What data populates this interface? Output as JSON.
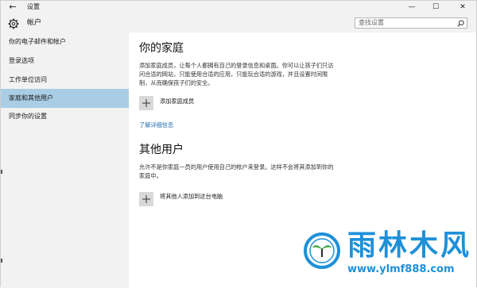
{
  "window": {
    "title": "设置",
    "back_glyph": "←",
    "controls": {
      "minimize": "—",
      "maximize": "☐",
      "close": "✕"
    }
  },
  "header": {
    "icon": "gear-icon",
    "title": "帐户",
    "search_placeholder": "查找设置"
  },
  "sidebar": {
    "items": [
      {
        "label": "你的电子邮件和帐户",
        "selected": false
      },
      {
        "label": "登录选项",
        "selected": false
      },
      {
        "label": "工作单位访问",
        "selected": false
      },
      {
        "label": "家庭和其他用户",
        "selected": true
      },
      {
        "label": "同步你的设置",
        "selected": false
      }
    ],
    "selected_color": "#a9cde5"
  },
  "main": {
    "family": {
      "title": "你的家庭",
      "description": "添加家庭成员，让每个人都拥有自己的登录信息和桌面。你可以让孩子们只访问合适的网站，只能使用合适的应用，只能玩合适的游戏，并且设置时间限制，从而确保孩子们的安全。",
      "add_label": "添加家庭成员",
      "learn_more": "了解详细信息"
    },
    "others": {
      "title": "其他用户",
      "description": "允许不是你家庭一员的用户使用自己的帐户来登录。这样不会将其添加到你的家庭中。",
      "add_label": "将其他人添加到这台电脑"
    }
  },
  "watermark": {
    "title": "雨林木风",
    "url": "www.ylmf888.com",
    "color": "#1e90d8"
  },
  "colors": {
    "chrome_bg": "#f2f2f2",
    "link": "#2a6fb0"
  }
}
